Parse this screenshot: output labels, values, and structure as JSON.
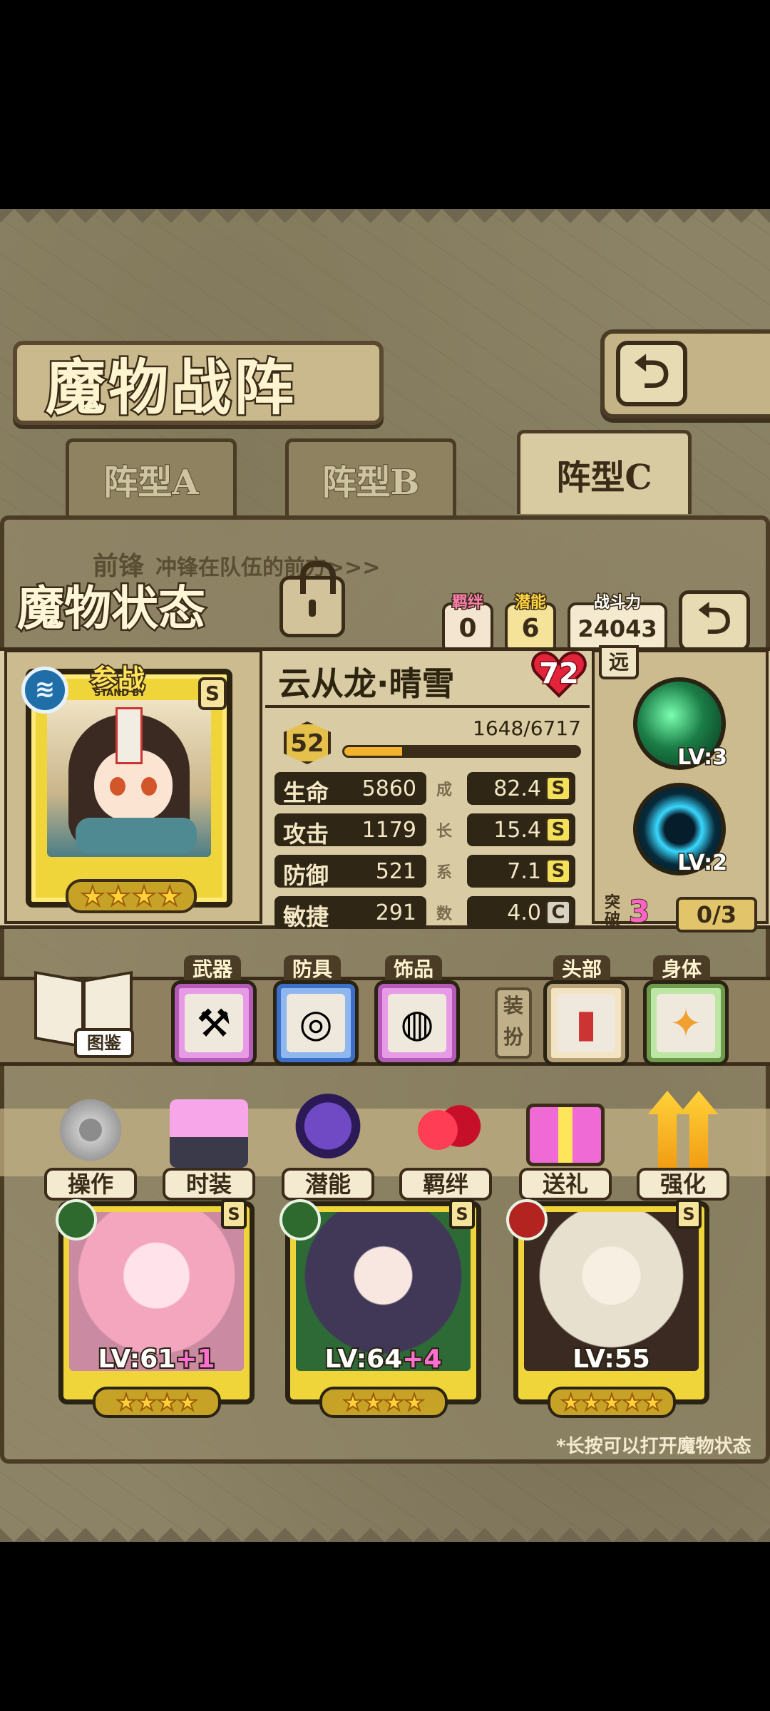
{
  "screen": {
    "title": "魔物战阵",
    "back_glyph": "⮌"
  },
  "formation_tabs": [
    {
      "label": "阵型A",
      "active": false
    },
    {
      "label": "阵型B",
      "active": false
    },
    {
      "label": "阵型C",
      "active": true
    }
  ],
  "vanguard": {
    "label": "前锋",
    "desc": "冲锋在队伍的前方>>>"
  },
  "status": {
    "title": "魔物状态",
    "bond_label": "羁绊",
    "bond_value": "0",
    "potential_label": "潜能",
    "potential_value": "6",
    "power_label": "战斗力",
    "power_value": "24043"
  },
  "monster": {
    "name": "云从龙·晴雪",
    "affection": "72",
    "standby": "参战",
    "standby_sub": "STAND BY",
    "rank": "S",
    "element_icon": "water-icon",
    "stars": 4,
    "level": "52",
    "exp_text": "1648/6717",
    "exp_fraction": 0.245,
    "range": "远",
    "stats": [
      {
        "name": "生命",
        "value": "5860",
        "growth": "82.4",
        "grade": "S"
      },
      {
        "name": "攻击",
        "value": "1179",
        "growth": "15.4",
        "grade": "S"
      },
      {
        "name": "防御",
        "value": "521",
        "growth": "7.1",
        "grade": "S"
      },
      {
        "name": "敏捷",
        "value": "291",
        "growth": "4.0",
        "grade": "C"
      }
    ],
    "growth_label": [
      "成",
      "长",
      "系",
      "数"
    ],
    "skills": [
      {
        "level": "LV:3"
      },
      {
        "level": "LV:2"
      }
    ],
    "breakthrough_label": "突破",
    "breakthrough_value": "3",
    "breakthrough_count": "0/3"
  },
  "equipment": {
    "codex_label": "图鉴",
    "weapon_label": "武器",
    "armor_label": "防具",
    "accessory_label": "饰品",
    "dress_label": "装扮",
    "head_label": "头部",
    "body_label": "身体"
  },
  "actions": [
    {
      "label": "操作",
      "icon": "gear-icon"
    },
    {
      "label": "时装",
      "icon": "outfit-icon"
    },
    {
      "label": "潜能",
      "icon": "potential-icon"
    },
    {
      "label": "羁绊",
      "icon": "hearts-icon"
    },
    {
      "label": "送礼",
      "icon": "gift-icon"
    },
    {
      "label": "强化",
      "icon": "upgrade-icon"
    }
  ],
  "team": [
    {
      "level": "LV:61",
      "plus": "+1",
      "rank": "S",
      "element": "grass",
      "stars": 4
    },
    {
      "level": "LV:64",
      "plus": "+4",
      "rank": "S",
      "element": "grass",
      "stars": 4
    },
    {
      "level": "LV:55",
      "plus": "",
      "rank": "S",
      "element": "fire",
      "stars": 5
    }
  ],
  "tip": "*长按可以打开魔物状态",
  "colors": {
    "accent_gold": "#f0d53a",
    "heart_red": "#e3233a",
    "frame_dark": "#3a2c18"
  }
}
